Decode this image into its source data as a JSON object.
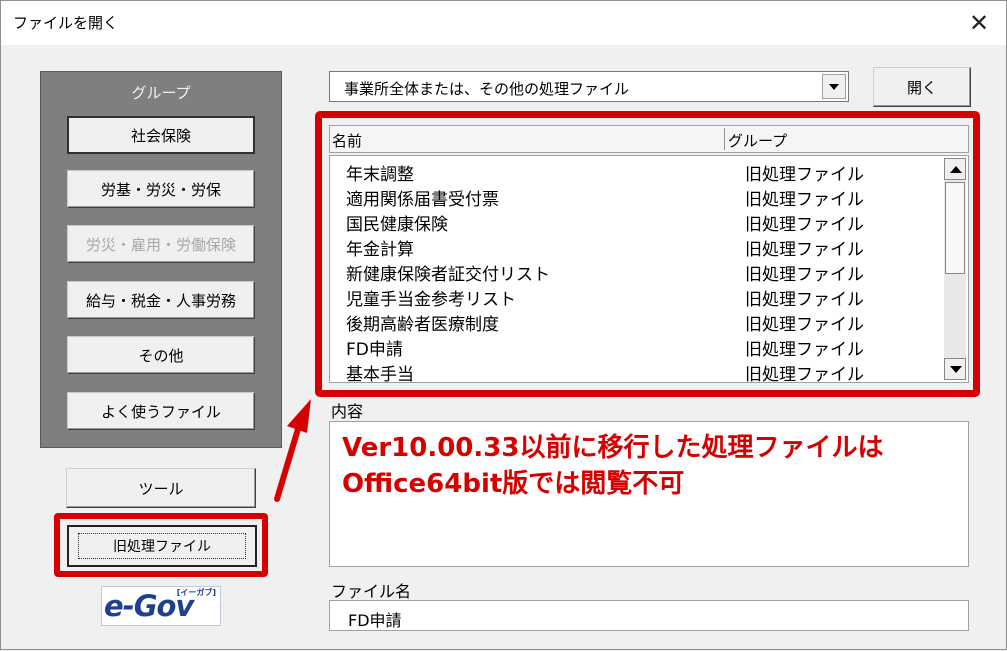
{
  "window": {
    "title": "ファイルを開く",
    "close_icon": "close-icon"
  },
  "group_panel": {
    "title": "グループ",
    "buttons": [
      {
        "label": "社会保険",
        "state": "selected"
      },
      {
        "label": "労基・労災・労保",
        "state": "normal"
      },
      {
        "label": "労災・雇用・労働保険",
        "state": "disabled"
      },
      {
        "label": "給与・税金・人事労務",
        "state": "normal"
      },
      {
        "label": "その他",
        "state": "normal"
      },
      {
        "label": "よく使うファイル",
        "state": "normal"
      }
    ]
  },
  "tools_button": {
    "label": "ツール"
  },
  "old_files_button": {
    "label": "旧処理ファイル"
  },
  "egov_logo": {
    "text": "e-Gov",
    "sub": "[イーガブ]"
  },
  "category_select": {
    "value": "事業所全体または、その他の処理ファイル"
  },
  "open_button": {
    "label": "開く"
  },
  "file_list": {
    "columns": [
      "名前",
      "グループ"
    ],
    "rows": [
      {
        "name": "年末調整",
        "group": "旧処理ファイル"
      },
      {
        "name": "適用関係届書受付票",
        "group": "旧処理ファイル"
      },
      {
        "name": "国民健康保険",
        "group": "旧処理ファイル"
      },
      {
        "name": "年金計算",
        "group": "旧処理ファイル"
      },
      {
        "name": "新健康保険者証交付リスト",
        "group": "旧処理ファイル"
      },
      {
        "name": "児童手当金参考リスト",
        "group": "旧処理ファイル"
      },
      {
        "name": "後期高齢者医療制度",
        "group": "旧処理ファイル"
      },
      {
        "name": "FD申請",
        "group": "旧処理ファイル"
      },
      {
        "name": "基本手当",
        "group": "旧処理ファイル"
      }
    ]
  },
  "description": {
    "label": "内容",
    "line1": "Ver10.00.33以前に移行した処理ファイルは",
    "line2": "Office64bit版では閲覧不可"
  },
  "filename": {
    "label": "ファイル名",
    "value": "FD申請"
  },
  "colors": {
    "highlight": "#d60000",
    "panel": "#7f7f7f"
  }
}
